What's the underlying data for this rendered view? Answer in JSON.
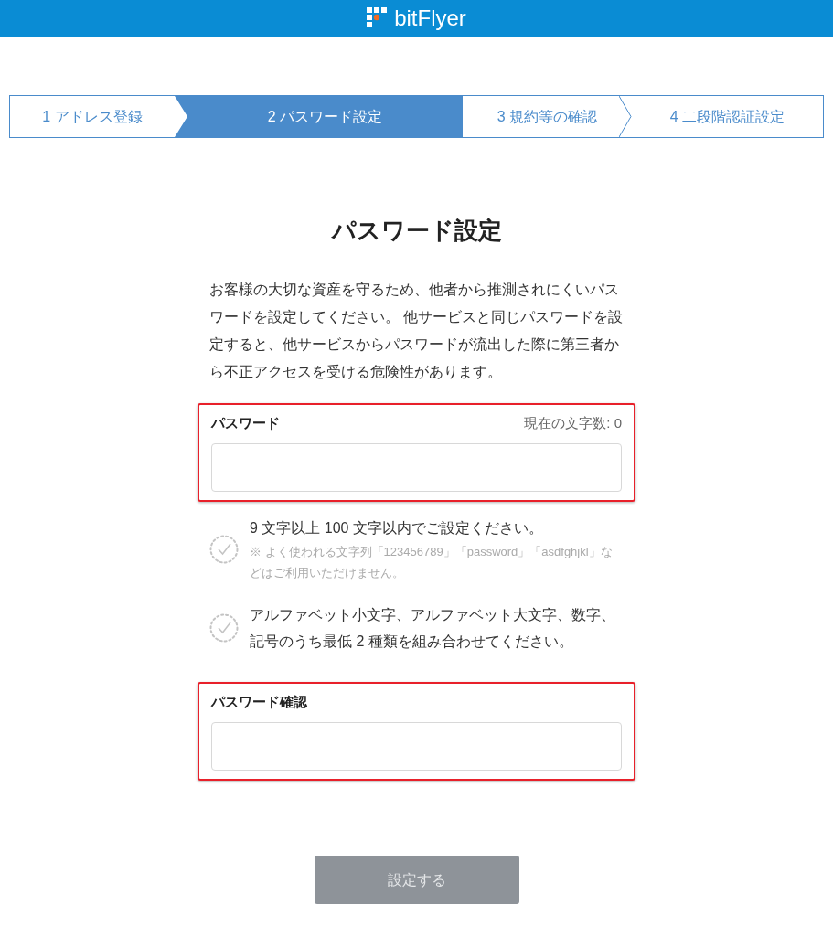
{
  "header": {
    "brand": "bitFlyer"
  },
  "steps": [
    {
      "label": "1 アドレス登録",
      "selected": false
    },
    {
      "label": "2 パスワード設定",
      "selected": true
    },
    {
      "label": "3 規約等の確認",
      "selected": false
    },
    {
      "label": "4 二段階認証設定",
      "selected": false
    }
  ],
  "heading": "パスワード設定",
  "intro": "お客様の大切な資産を守るため、他者から推測されにくいパスワードを設定してください。 他サービスと同じパスワードを設定すると、他サービスからパスワードが流出した際に第三者から不正アクセスを受ける危険性があります。",
  "password": {
    "label": "パスワード",
    "counter": "現在の文字数: 0",
    "highlighted": true
  },
  "rules": [
    {
      "text": "9 文字以上 100 文字以内でご設定ください。",
      "note": "※ よく使われる文字列「123456789」「password」「asdfghjkl」などはご利用いただけません。",
      "met": false
    },
    {
      "text": "アルファベット小文字、アルファベット大文字、数字、記号のうち最低 2 種類を組み合わせてください。",
      "met": false
    }
  ],
  "confirm": {
    "label": "パスワード確認",
    "highlighted": true
  },
  "submit": {
    "label": "設定する",
    "disabled": true
  }
}
